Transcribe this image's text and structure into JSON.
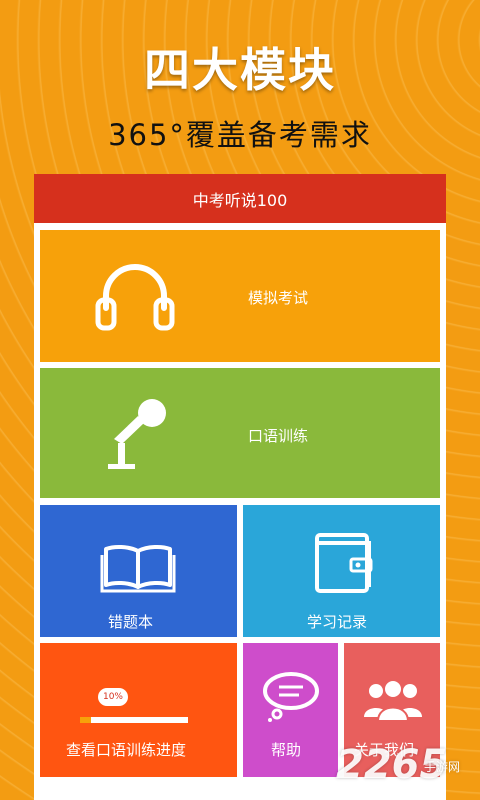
{
  "promo": {
    "title": "四大模块",
    "subtitle": "365°覆盖备考需求"
  },
  "app": {
    "title": "中考听说100"
  },
  "tiles": [
    {
      "label": "模拟考试",
      "icon": "headphones-icon",
      "color": "#f7a10a"
    },
    {
      "label": "口语训练",
      "icon": "microphone-icon",
      "color": "#8ab93b"
    },
    {
      "label": "错题本",
      "icon": "open-book-icon",
      "color": "#2f67d2"
    },
    {
      "label": "学习记录",
      "icon": "wallet-icon",
      "color": "#2aa6d9"
    },
    {
      "label": "查看口语训练进度",
      "icon": "progress-icon",
      "color": "#ff5511"
    },
    {
      "label": "帮助",
      "icon": "chat-bubble-icon",
      "color": "#ce4dcb"
    },
    {
      "label": "关于我们",
      "icon": "people-icon",
      "color": "#e85f5d"
    }
  ],
  "progress": {
    "percent_label": "10%",
    "fraction": 0.1
  },
  "watermark": {
    "logo": "2265",
    "site": "手游网"
  },
  "colors": {
    "background": "#f39c12",
    "header": "#d6301d"
  }
}
